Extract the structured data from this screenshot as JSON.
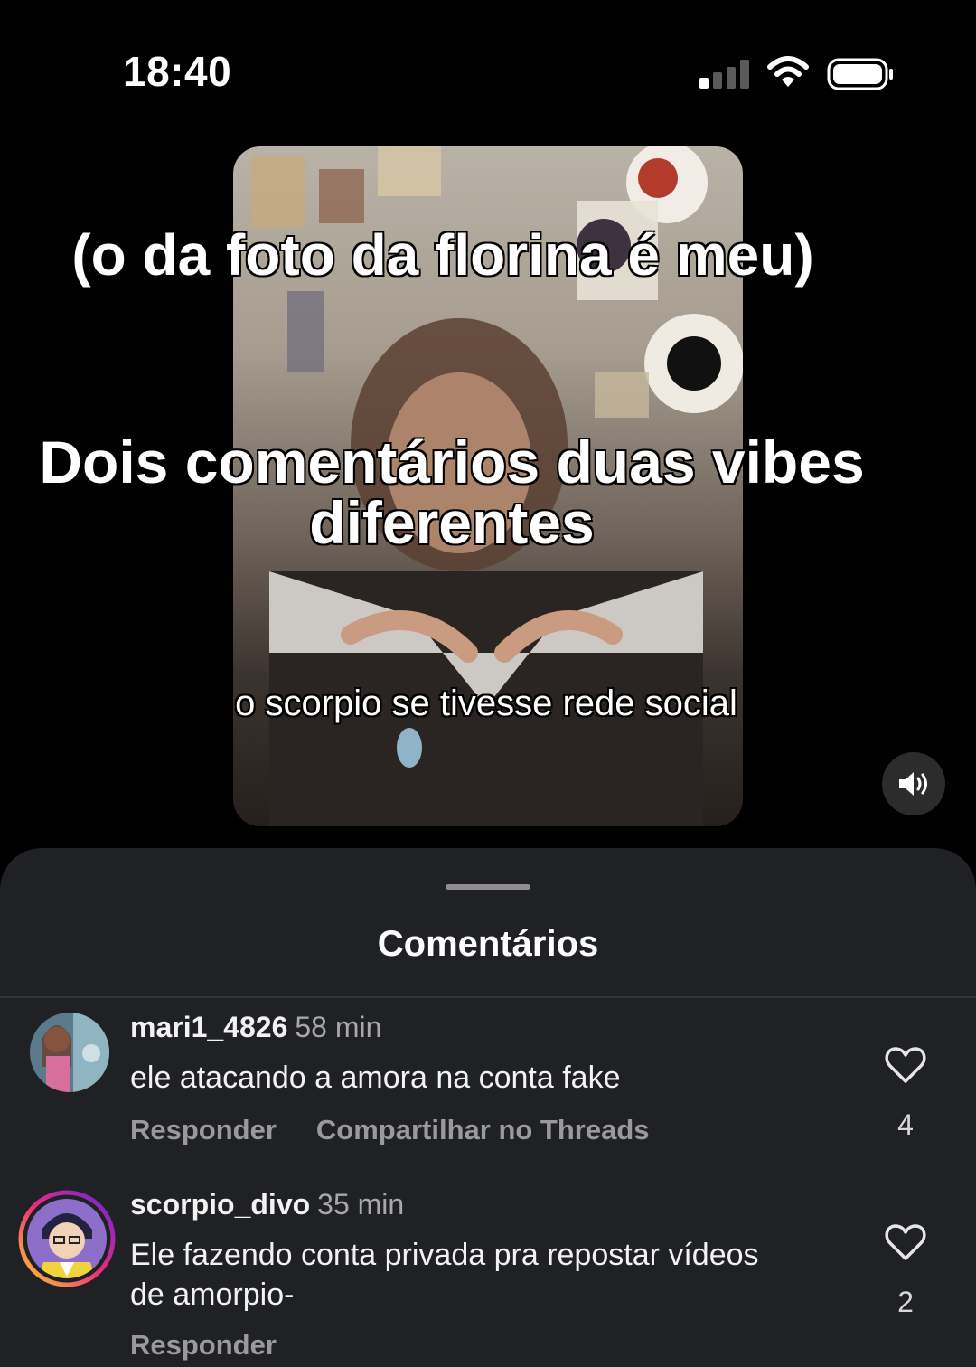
{
  "status_bar": {
    "time": "18:40",
    "signal_bars": 4,
    "signal_bars_active": 1
  },
  "video": {
    "caption_top": "(o da foto da florina é meu)",
    "caption_main": "Dois comentários duas vibes diferentes",
    "subtitle": "o scorpio se tivesse rede social"
  },
  "comments_sheet": {
    "title": "Comentários",
    "comments": [
      {
        "username": "mari1_4826",
        "time": "58 min",
        "text": "ele atacando a amora na conta fake",
        "reply_label": "Responder",
        "share_label": "Compartilhar no Threads",
        "likes": "4",
        "avatar": "avatar-illustration"
      },
      {
        "username": "scorpio_divo",
        "time": "35 min",
        "text": "Ele fazendo conta privada pra repostar vídeos de amorpio-",
        "reply_label": "Responder",
        "likes": "2",
        "avatar": "avatar-cartoon-with-story-ring"
      }
    ]
  },
  "colors": {
    "background": "#000000",
    "sheet": "#202124",
    "secondary_text": "#a8a8a8",
    "story_ring_start": "#f9ce34",
    "story_ring_mid": "#ee2a7b",
    "story_ring_end": "#6228d7"
  }
}
